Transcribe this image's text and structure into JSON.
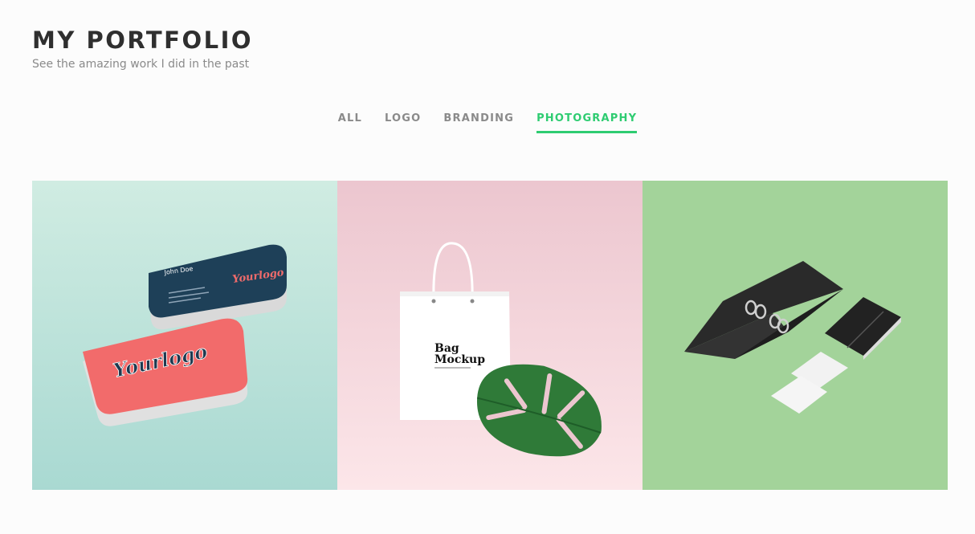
{
  "header": {
    "title": "MY PORTFOLIO",
    "subtitle": "See the amazing work I did in the past"
  },
  "filters": [
    {
      "label": "ALL",
      "active": false
    },
    {
      "label": "LOGO",
      "active": false
    },
    {
      "label": "BRANDING",
      "active": false
    },
    {
      "label": "PHOTOGRAPHY",
      "active": true
    }
  ],
  "colors": {
    "accent": "#2ecc71",
    "tile1_bg": "#bfe3da",
    "tile2_bg": "#f1d3da",
    "tile3_bg": "#a3d39a"
  },
  "portfolio": {
    "items": [
      {
        "subject": "business-cards-mockup-icon",
        "front_logo": "Yourlogo",
        "back_logo": "Yourlogo",
        "back_name": "John Doe"
      },
      {
        "subject": "shopping-bag-mockup-icon",
        "bag_line1": "Bag",
        "bag_line2": "Mockup"
      },
      {
        "subject": "stationery-mockup-icon"
      }
    ]
  }
}
